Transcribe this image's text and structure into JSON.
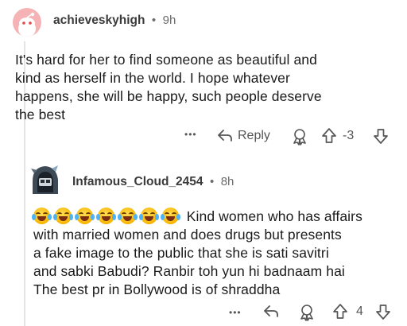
{
  "comment": {
    "username": "achieveskyhigh",
    "separator": "•",
    "age": "9h",
    "lines": [
      "It's hard for her to find someone as beautiful and",
      "kind as herself in the world. I hope whatever",
      "happens, she will be happy, such people deserve",
      "the best"
    ],
    "actions": {
      "more": "•••",
      "reply_label": "Reply",
      "score": "-3"
    }
  },
  "reply": {
    "username": "Infamous_Cloud_2454",
    "separator": "•",
    "age": "8h",
    "emoji_count": 7,
    "first_line_text": "Kind women who has affairs",
    "lines": [
      "with married women and does drugs but presents",
      "a fake image to the public that she is sati savitri",
      "and sabki Babudi? Ranbir toh yun hi badnaam hai",
      "The best pr in Bollywood is of shraddha"
    ],
    "actions": {
      "more": "•••",
      "score": "4"
    }
  },
  "colors": {
    "avatar1": "#f2a8ab",
    "thread_line": "#d0d0d0",
    "text": "#1a1a1a",
    "meta": "#6b6b6b"
  }
}
